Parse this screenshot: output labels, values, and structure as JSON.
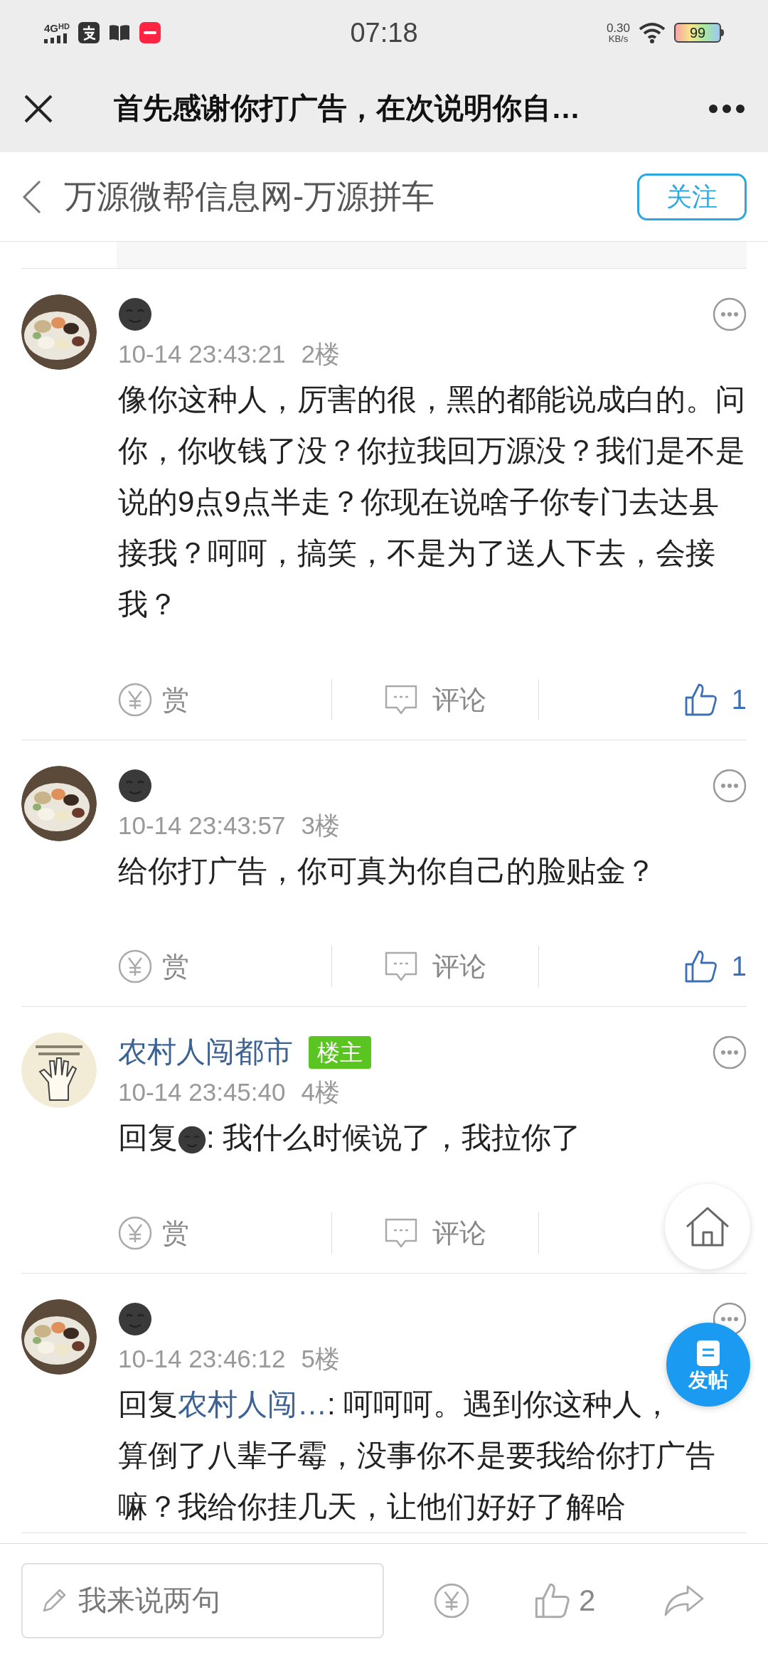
{
  "status_bar": {
    "network": "4G",
    "hd": "HD",
    "time": "07:18",
    "speed": "0.30",
    "speed_unit": "KB/s",
    "battery": "99"
  },
  "title_bar": {
    "title": "首先感谢你打广告，在次说明你自…"
  },
  "header": {
    "title": "万源微帮信息网-万源拼车",
    "follow_button": "关注"
  },
  "comments": [
    {
      "author": {
        "kind": "emoji"
      },
      "time": "10-14 23:43:21",
      "floor": "2楼",
      "body": {
        "text": "像你这种人，厉害的很，黑的都能说成白的。问你，你收钱了没？你拉我回万源没？我们是不是说的9点9点半走？你现在说啥子你专门去达县接我？呵呵，搞笑，不是为了送人下去，会接我？"
      },
      "actions": {
        "reward": "赏",
        "comment": "评论",
        "like": "1",
        "liked": true
      }
    },
    {
      "author": {
        "kind": "emoji"
      },
      "time": "10-14 23:43:57",
      "floor": "3楼",
      "body": {
        "text": "给你打广告，你可真为你自己的脸贴金？"
      },
      "actions": {
        "reward": "赏",
        "comment": "评论",
        "like": "1",
        "liked": true
      }
    },
    {
      "author": {
        "kind": "text",
        "name": "农村人闯都市",
        "badge": "楼主"
      },
      "time": "10-14 23:45:40",
      "floor": "4楼",
      "body": {
        "reply_prefix": "回复",
        "reply_to": {
          "kind": "emoji"
        },
        "text": ": 我什么时候说了，我拉你了"
      },
      "actions": {
        "reward": "赏",
        "comment": "评论"
      }
    },
    {
      "author": {
        "kind": "emoji"
      },
      "time": "10-14 23:46:12",
      "floor": "5楼",
      "body": {
        "reply_prefix": "回复",
        "reply_to": {
          "kind": "text",
          "name": "农村人闯…"
        },
        "text": ": 呵呵呵。遇到你这种人，",
        "text_2": "算倒了八辈子霉，没事你不是要我给你打广告嘛？我给你挂几天，让他们好好了解哈"
      }
    }
  ],
  "floating": {
    "post_button": "发帖"
  },
  "bottom_bar": {
    "placeholder": "我来说两句",
    "likes": "2"
  }
}
